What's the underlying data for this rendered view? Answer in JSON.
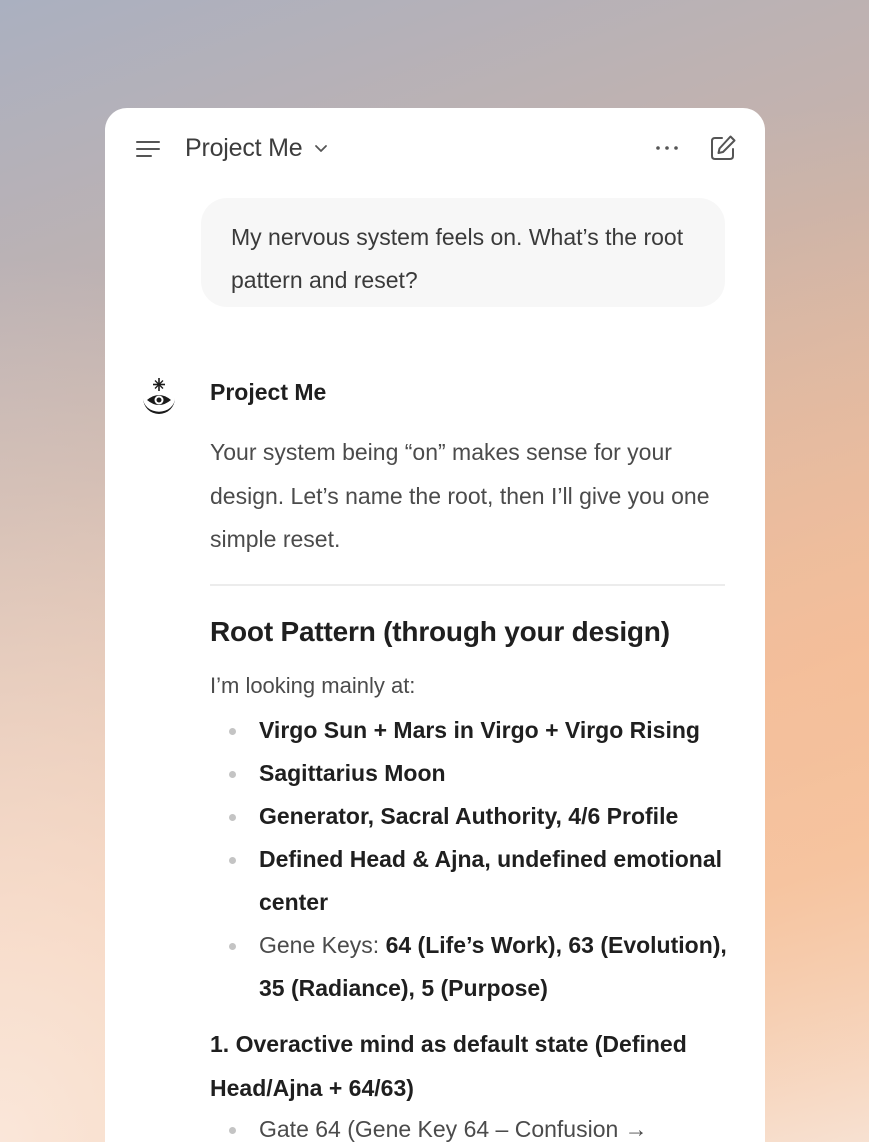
{
  "header": {
    "title": "Project Me",
    "menu_icon": "menu-icon",
    "chevron_icon": "chevron-down-icon",
    "more_icon": "more-horizontal-icon",
    "edit_icon": "compose-icon"
  },
  "conversation": {
    "user_message": "My nervous system feels on. What’s the root pattern and reset?",
    "assistant": {
      "name": "Project Me",
      "avatar_icon": "eye-moon-star-icon",
      "intro": "Your system being “on” makes sense for your design. Let’s name the root, then I’ll give you one simple reset.",
      "section_heading": "Root Pattern (through your design)",
      "lead": "I’m looking mainly at:",
      "bullets": [
        "Virgo Sun + Mars in Virgo + Virgo Rising",
        "Sagittarius Moon",
        "Generator, Sacral Authority, 4/6 Profile",
        "Defined Head & Ajna, undefined emotional center"
      ],
      "gene_keys_label": "Gene Keys: ",
      "gene_keys_value": "64 (Life’s Work), 63 (Evolution), 35 (Radiance), 5 (Purpose)",
      "numbered_item": "1. Overactive mind as default state (Defined Head/Ajna + 64/63)",
      "sub_bullets": [
        "Gate 64 (Gene Key 64 – Confusion →"
      ]
    }
  },
  "colors": {
    "card_background": "#ffffff",
    "bubble_background": "#f7f7f7",
    "text_primary": "#1f1f1f",
    "text_secondary": "#4b4b4b"
  }
}
